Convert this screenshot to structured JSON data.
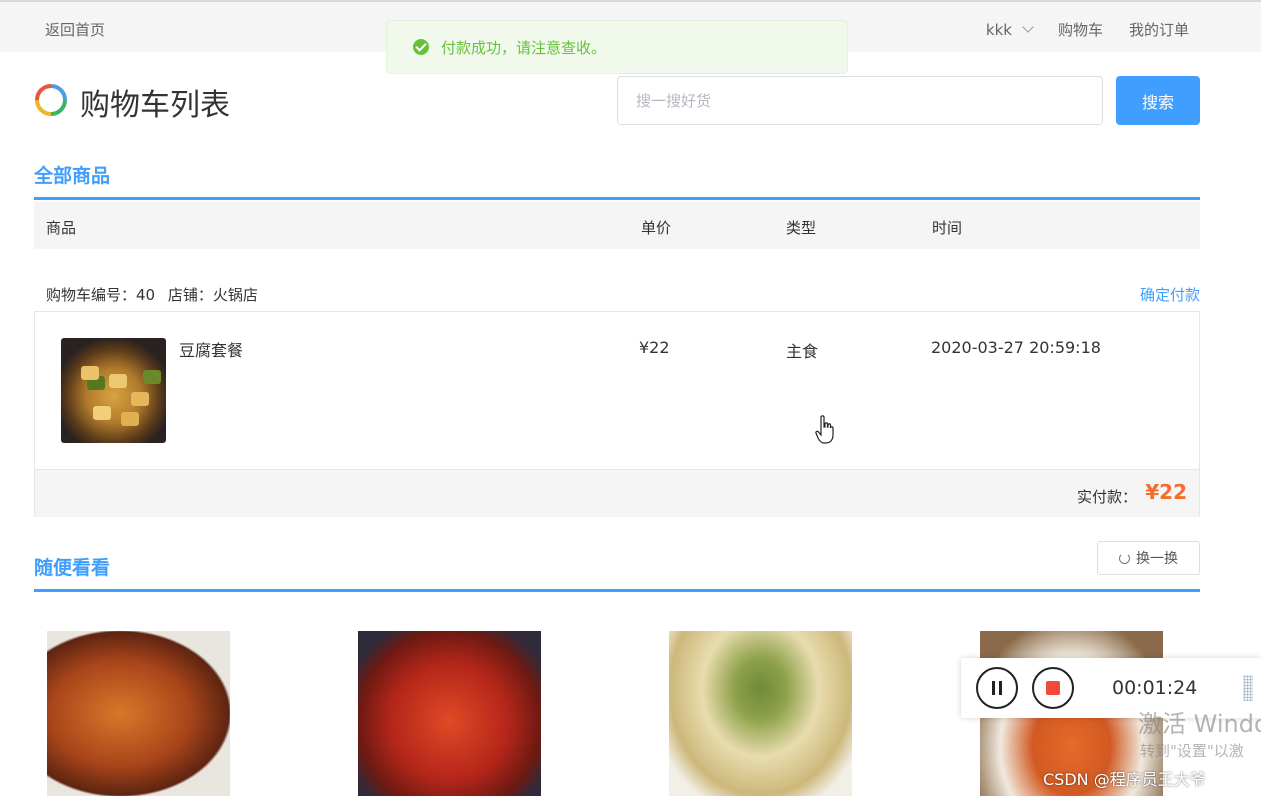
{
  "nav": {
    "back_home": "返回首页",
    "username": "kkk",
    "cart_link": "购物车",
    "orders_link": "我的订单"
  },
  "toast": {
    "message": "付款成功，请注意查收。"
  },
  "header": {
    "title": "购物车列表",
    "search_placeholder": "搜一搜好货",
    "search_button": "搜索"
  },
  "all_goods": {
    "section_title": "全部商品",
    "columns": {
      "goods": "商品",
      "price": "单价",
      "type": "类型",
      "time": "时间"
    },
    "cart": {
      "number_label": "购物车编号：",
      "number": "40",
      "shop_label": "店铺：",
      "shop": "火锅店",
      "confirm_pay": "确定付款",
      "item": {
        "name": "豆腐套餐",
        "price": "¥22",
        "type": "主食",
        "time": "2020-03-27 20:59:18"
      },
      "paid_label": "实付款：",
      "paid_amount": "¥22"
    }
  },
  "browse": {
    "section_title": "随便看看",
    "refresh_button": "换一换"
  },
  "recorder": {
    "elapsed": "00:01:24"
  },
  "overlay": {
    "windows_activate": "激活 Windo",
    "windows_hint": "转到\"设置\"以激",
    "watermark": "CSDN @程序员王大爷"
  },
  "colors": {
    "accent": "#409eff",
    "success": "#67c23a",
    "price": "#f56c2d"
  }
}
